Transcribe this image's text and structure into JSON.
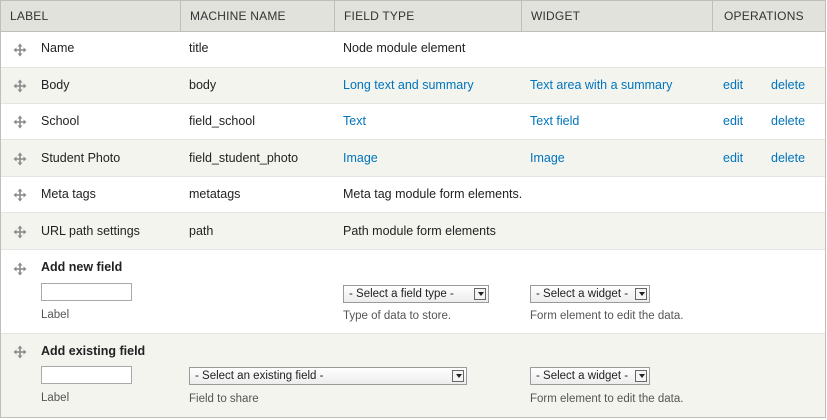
{
  "headers": {
    "label": "LABEL",
    "machine_name": "MACHINE NAME",
    "field_type": "FIELD TYPE",
    "widget": "WIDGET",
    "operations": "OPERATIONS"
  },
  "rows": [
    {
      "label": "Name",
      "machine_name": "title",
      "field_type": "Node module element"
    },
    {
      "label": "Body",
      "machine_name": "body",
      "field_type": "Long text and summary",
      "widget": "Text area with a summary",
      "edit": "edit",
      "delete": "delete"
    },
    {
      "label": "School",
      "machine_name": "field_school",
      "field_type": "Text",
      "widget": "Text field",
      "edit": "edit",
      "delete": "delete"
    },
    {
      "label": "Student Photo",
      "machine_name": "field_student_photo",
      "field_type": "Image",
      "widget": "Image",
      "edit": "edit",
      "delete": "delete"
    },
    {
      "label": "Meta tags",
      "machine_name": "metatags",
      "field_type": "Meta tag module form elements."
    },
    {
      "label": "URL path settings",
      "machine_name": "path",
      "field_type": "Path module form elements"
    }
  ],
  "add_new": {
    "title": "Add new field",
    "label_value": "",
    "label_desc": "Label",
    "type_select": "- Select a field type -",
    "type_desc": "Type of data to store.",
    "widget_select": "- Select a widget -",
    "widget_desc": "Form element to edit the data."
  },
  "add_existing": {
    "title": "Add existing field",
    "label_value": "",
    "label_desc": "Label",
    "field_select": "- Select an existing field -",
    "field_desc": "Field to share",
    "widget_select": "- Select a widget -",
    "widget_desc": "Form element to edit the data."
  },
  "icons": {
    "drag": "drag-handle-icon"
  },
  "colors": {
    "link": "#0074bd",
    "header_bg": "#e1e2dc",
    "stripe": "#f3f4ee"
  }
}
